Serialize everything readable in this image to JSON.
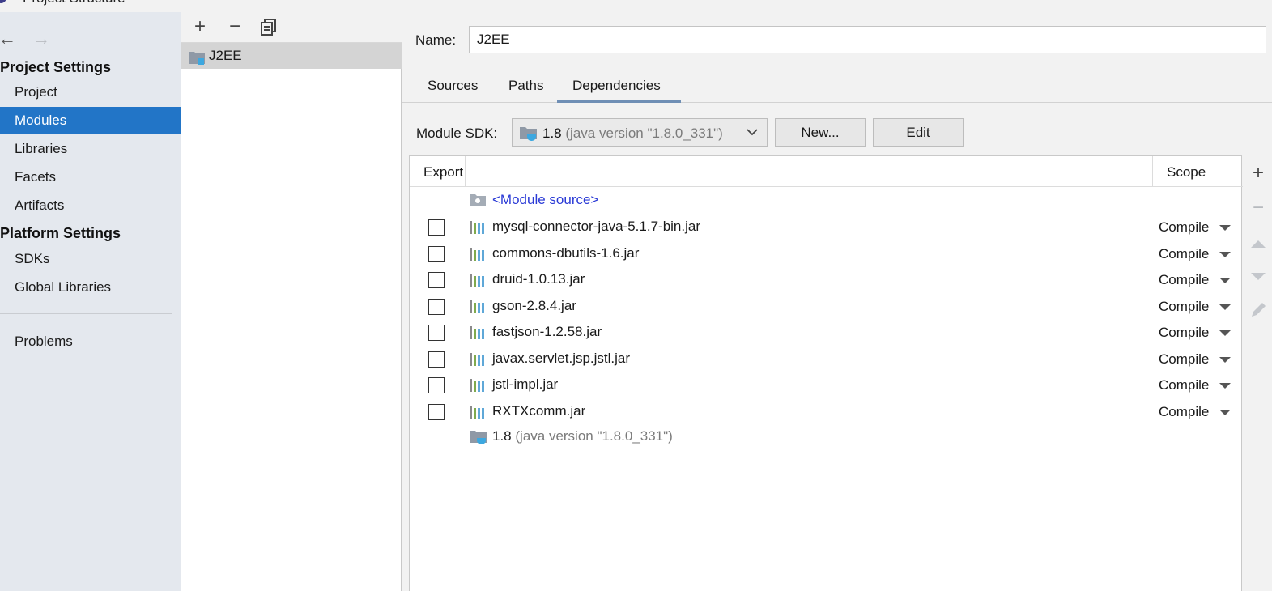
{
  "window": {
    "title": "Project Structure"
  },
  "sidebar": {
    "project_settings_header": "Project Settings",
    "project_settings_items": [
      {
        "label": "Project",
        "selected": false
      },
      {
        "label": "Modules",
        "selected": true
      },
      {
        "label": "Libraries",
        "selected": false
      },
      {
        "label": "Facets",
        "selected": false
      },
      {
        "label": "Artifacts",
        "selected": false
      }
    ],
    "platform_settings_header": "Platform Settings",
    "platform_settings_items": [
      {
        "label": "SDKs"
      },
      {
        "label": "Global Libraries"
      }
    ],
    "problems_label": "Problems",
    "icons": {
      "back": "arrow-left-icon",
      "forward": "arrow-right-icon"
    }
  },
  "modules": {
    "toolbar": {
      "add": "+",
      "remove": "−",
      "copy": "copy-icon"
    },
    "items": [
      {
        "label": "J2EE",
        "selected": true
      }
    ]
  },
  "details": {
    "name_label": "Name:",
    "name_value": "J2EE",
    "tabs": [
      {
        "label": "Sources",
        "active": false
      },
      {
        "label": "Paths",
        "active": false
      },
      {
        "label": "Dependencies",
        "active": true
      }
    ],
    "sdk_label": "Module SDK:",
    "sdk_version": "1.8",
    "sdk_version_detail": "(java version \"1.8.0_331\")",
    "new_button": "New...",
    "edit_button": "Edit",
    "table": {
      "col_export": "Export",
      "col_scope": "Scope",
      "module_source": "<Module source>",
      "rows": [
        {
          "name": "mysql-connector-java-5.1.7-bin.jar",
          "scope": "Compile",
          "exported": false
        },
        {
          "name": "commons-dbutils-1.6.jar",
          "scope": "Compile",
          "exported": false
        },
        {
          "name": "druid-1.0.13.jar",
          "scope": "Compile",
          "exported": false
        },
        {
          "name": "gson-2.8.4.jar",
          "scope": "Compile",
          "exported": false
        },
        {
          "name": "fastjson-1.2.58.jar",
          "scope": "Compile",
          "exported": false
        },
        {
          "name": "javax.servlet.jsp.jstl.jar",
          "scope": "Compile",
          "exported": false
        },
        {
          "name": "jstl-impl.jar",
          "scope": "Compile",
          "exported": false
        },
        {
          "name": "RXTXcomm.jar",
          "scope": "Compile",
          "exported": false
        }
      ],
      "sdk_row_version": "1.8",
      "sdk_row_detail": "(java version \"1.8.0_331\")"
    },
    "side_tools": [
      "plus-icon",
      "minus-icon",
      "move-up-icon",
      "move-down-icon",
      "edit-pencil-icon"
    ]
  },
  "colors": {
    "selection": "#2275c7",
    "link_blue": "#2a3ad6",
    "lib_icon_green": "#7faa4e",
    "lib_icon_blue": "#5fa8d8",
    "sidebar_bg": "#e4e8ee"
  }
}
